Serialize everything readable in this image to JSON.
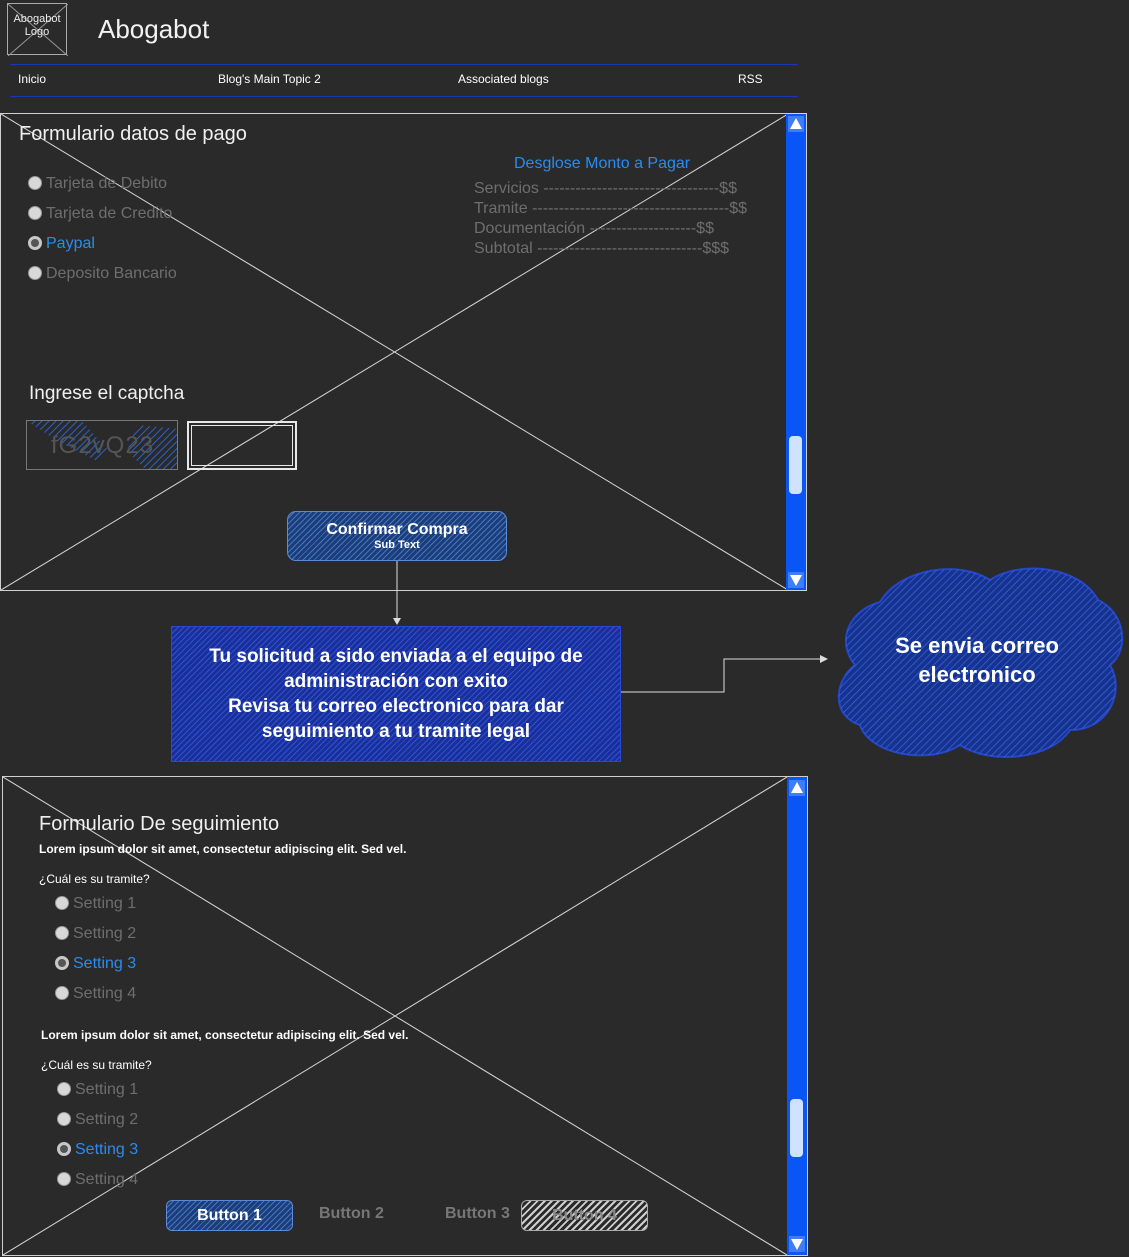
{
  "header": {
    "logo_text": "Abogabot Logo",
    "title": "Abogabot",
    "nav": [
      "Inicio",
      "Blog's Main Topic 2",
      "Associated blogs",
      "RSS"
    ]
  },
  "payment_form": {
    "title": "Formulario datos de pago",
    "options": [
      {
        "label": "Tarjeta de Debito",
        "selected": false
      },
      {
        "label": "Tarjeta de Credito",
        "selected": false
      },
      {
        "label": "Paypal",
        "selected": true
      },
      {
        "label": "Deposito Bancario",
        "selected": false
      }
    ],
    "breakdown": {
      "title": "Desglose Monto a Pagar",
      "lines": [
        "Servicios ---------------------------------$$",
        "Tramite -------------------------------------$$",
        "Documentación --------------------$$",
        "Subtotal -------------------------------$$$"
      ]
    },
    "captcha_label": "Ingrese el captcha",
    "captcha_text": "fG2vQ23",
    "confirm_button": {
      "label": "Confirmar Compra",
      "subtext": "Sub Text"
    }
  },
  "message": {
    "lines": [
      "Tu solicitud a sido enviada a el equipo de",
      "administración con exito",
      "Revisa tu correo electronico para dar",
      "seguimiento a tu tramite legal"
    ]
  },
  "cloud": {
    "lines": [
      "Se envia correo",
      "electronico"
    ]
  },
  "followup_form": {
    "title": "Formulario De seguimiento",
    "groups": [
      {
        "description": "Lorem ipsum dolor sit amet, consectetur adipiscing elit. Sed vel.",
        "question": "¿Cuál es su tramite?",
        "options": [
          {
            "label": "Setting 1",
            "selected": false
          },
          {
            "label": "Setting 2",
            "selected": false
          },
          {
            "label": "Setting 3",
            "selected": true
          },
          {
            "label": "Setting 4",
            "selected": false
          }
        ]
      },
      {
        "description": "Lorem ipsum dolor sit amet, consectetur adipiscing elit. Sed vel.",
        "question": "¿Cuál es su tramite?",
        "options": [
          {
            "label": "Setting 1",
            "selected": false
          },
          {
            "label": "Setting 2",
            "selected": false
          },
          {
            "label": "Setting 3",
            "selected": true
          },
          {
            "label": "Setting 4",
            "selected": false
          }
        ]
      }
    ],
    "buttons": [
      "Button 1",
      "Button 2",
      "Button 3",
      "Button 4"
    ]
  },
  "colors": {
    "accent": "#2a8cf0",
    "scrollbar": "#0a55f5",
    "background": "#2a2a2a"
  }
}
